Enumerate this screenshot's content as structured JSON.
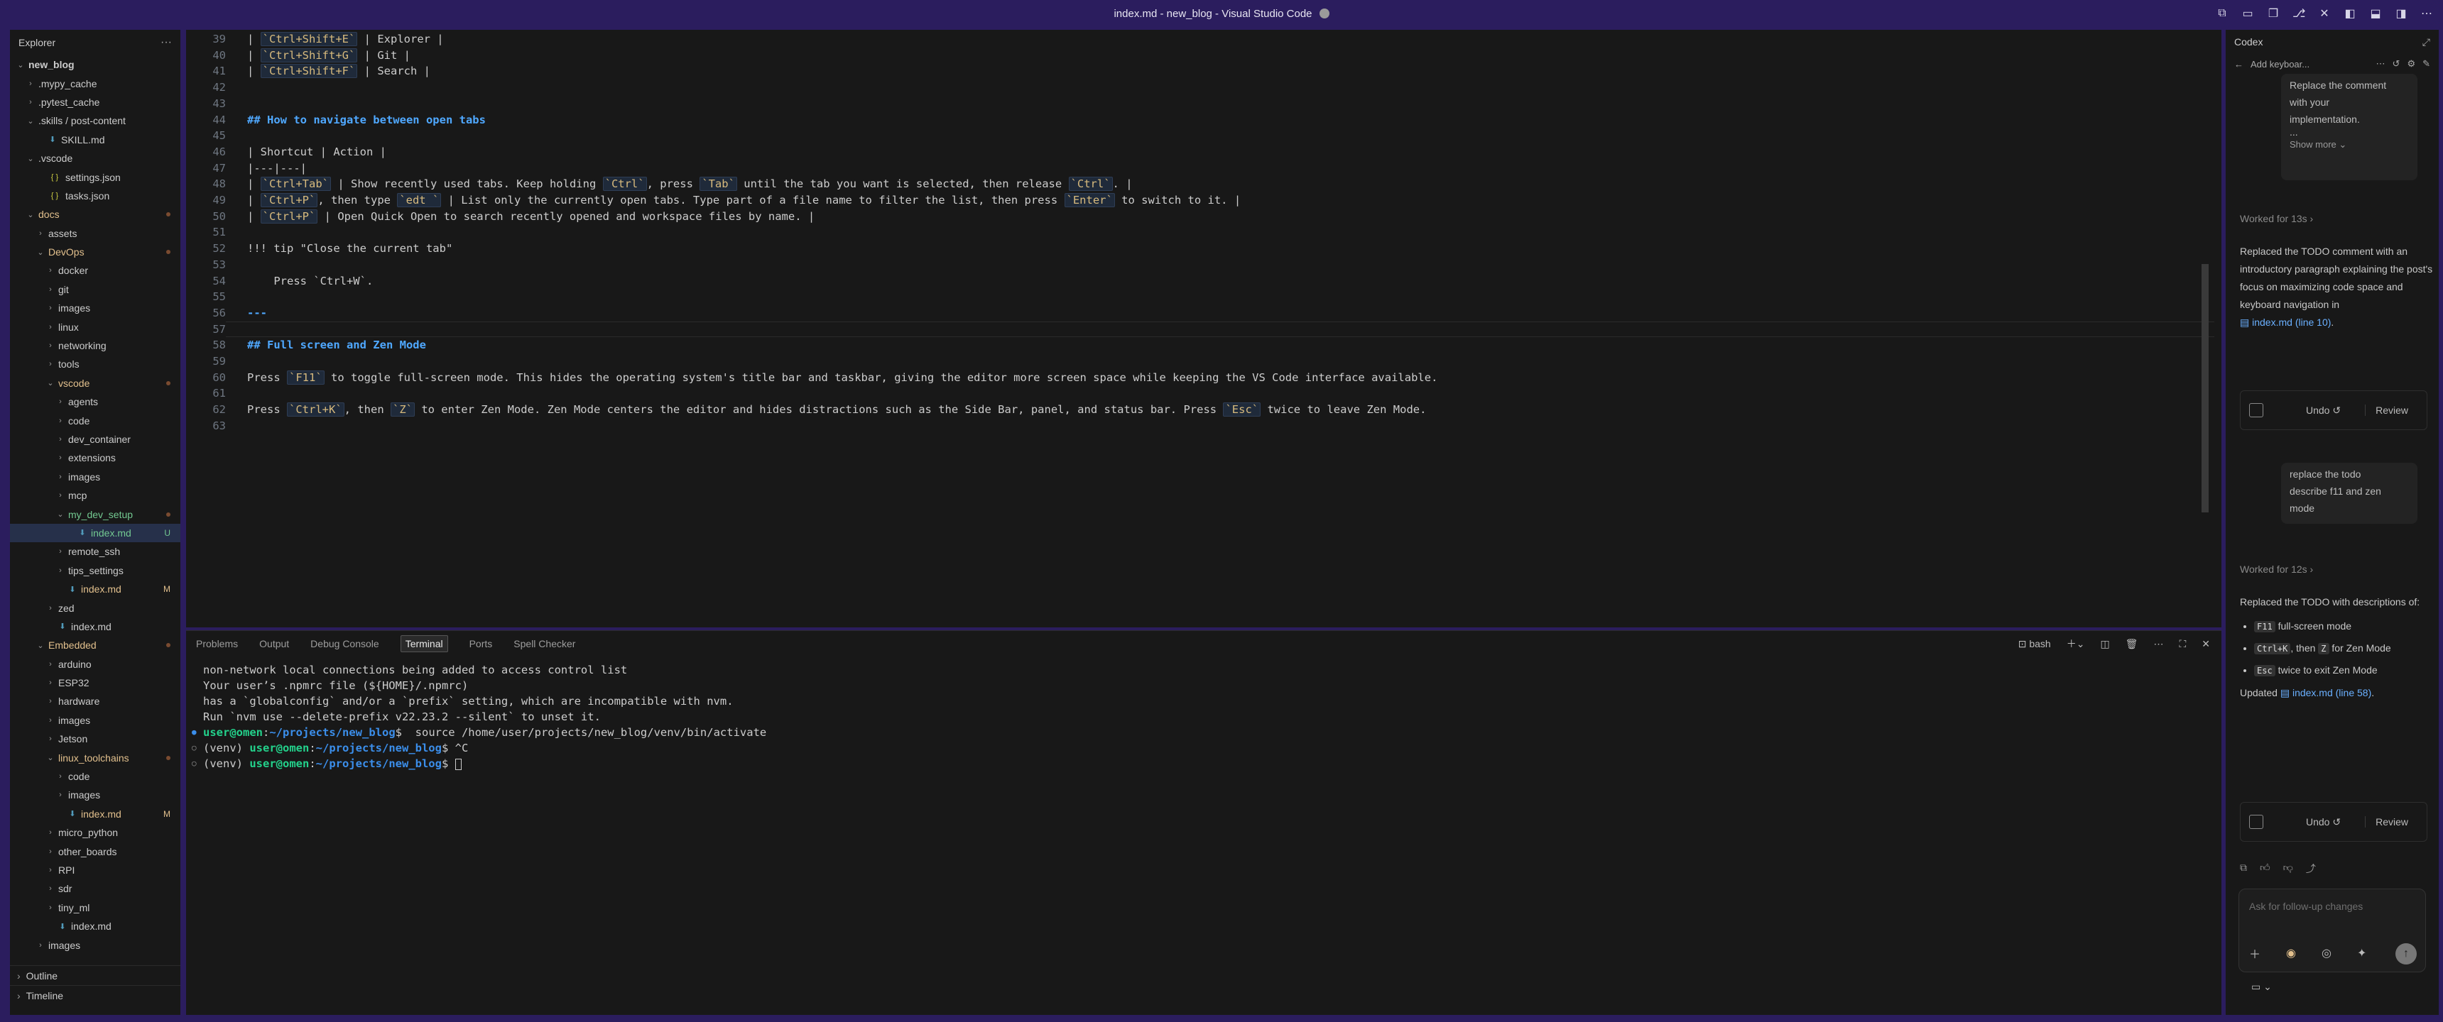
{
  "window": {
    "title": "index.md - new_blog - Visual Studio Code"
  },
  "explorer": {
    "title": "Explorer",
    "more": "···",
    "items": [
      {
        "label": "new_blog",
        "indent": 0,
        "kind": "root",
        "color": "def"
      },
      {
        "label": ".mypy_cache",
        "indent": 1,
        "kind": "folder",
        "color": "def"
      },
      {
        "label": ".pytest_cache",
        "indent": 1,
        "kind": "folder",
        "color": "def"
      },
      {
        "label": ".skills / post-content",
        "indent": 1,
        "kind": "open",
        "color": "def"
      },
      {
        "label": "SKILL.md",
        "indent": 2,
        "kind": "md",
        "color": "def"
      },
      {
        "label": ".vscode",
        "indent": 1,
        "kind": "open",
        "color": "def"
      },
      {
        "label": "settings.json",
        "indent": 2,
        "kind": "json",
        "color": "def"
      },
      {
        "label": "tasks.json",
        "indent": 2,
        "kind": "json",
        "color": "def"
      },
      {
        "label": "docs",
        "indent": 1,
        "kind": "open",
        "color": "mod",
        "dot": true
      },
      {
        "label": "assets",
        "indent": 2,
        "kind": "folder",
        "color": "def"
      },
      {
        "label": "DevOps",
        "indent": 2,
        "kind": "open",
        "color": "mod",
        "dot": true
      },
      {
        "label": "docker",
        "indent": 3,
        "kind": "folder",
        "color": "def"
      },
      {
        "label": "git",
        "indent": 3,
        "kind": "folder",
        "color": "def"
      },
      {
        "label": "images",
        "indent": 3,
        "kind": "folder",
        "color": "def"
      },
      {
        "label": "linux",
        "indent": 3,
        "kind": "folder",
        "color": "def"
      },
      {
        "label": "networking",
        "indent": 3,
        "kind": "folder",
        "color": "def"
      },
      {
        "label": "tools",
        "indent": 3,
        "kind": "folder",
        "color": "def"
      },
      {
        "label": "vscode",
        "indent": 3,
        "kind": "open",
        "color": "mod",
        "dot": true
      },
      {
        "label": "agents",
        "indent": 4,
        "kind": "folder",
        "color": "def"
      },
      {
        "label": "code",
        "indent": 4,
        "kind": "folder",
        "color": "def"
      },
      {
        "label": "dev_container",
        "indent": 4,
        "kind": "folder",
        "color": "def"
      },
      {
        "label": "extensions",
        "indent": 4,
        "kind": "folder",
        "color": "def"
      },
      {
        "label": "images",
        "indent": 4,
        "kind": "folder",
        "color": "def"
      },
      {
        "label": "mcp",
        "indent": 4,
        "kind": "folder",
        "color": "def"
      },
      {
        "label": "my_dev_setup",
        "indent": 4,
        "kind": "open",
        "color": "unt",
        "dot": true
      },
      {
        "label": "index.md",
        "indent": 5,
        "kind": "md",
        "color": "unt",
        "badge": "U",
        "selected": true
      },
      {
        "label": "remote_ssh",
        "indent": 4,
        "kind": "folder",
        "color": "def"
      },
      {
        "label": "tips_settings",
        "indent": 4,
        "kind": "folder",
        "color": "def"
      },
      {
        "label": "index.md",
        "indent": 4,
        "kind": "md",
        "color": "mod",
        "badge": "M"
      },
      {
        "label": "zed",
        "indent": 3,
        "kind": "folder",
        "color": "def"
      },
      {
        "label": "index.md",
        "indent": 3,
        "kind": "md",
        "color": "def"
      },
      {
        "label": "Embedded",
        "indent": 2,
        "kind": "open",
        "color": "mod",
        "dot": true
      },
      {
        "label": "arduino",
        "indent": 3,
        "kind": "folder",
        "color": "def"
      },
      {
        "label": "ESP32",
        "indent": 3,
        "kind": "folder",
        "color": "def"
      },
      {
        "label": "hardware",
        "indent": 3,
        "kind": "folder",
        "color": "def"
      },
      {
        "label": "images",
        "indent": 3,
        "kind": "folder",
        "color": "def"
      },
      {
        "label": "Jetson",
        "indent": 3,
        "kind": "folder",
        "color": "def"
      },
      {
        "label": "linux_toolchains",
        "indent": 3,
        "kind": "open",
        "color": "mod",
        "dot": true
      },
      {
        "label": "code",
        "indent": 4,
        "kind": "folder",
        "color": "def"
      },
      {
        "label": "images",
        "indent": 4,
        "kind": "folder",
        "color": "def"
      },
      {
        "label": "index.md",
        "indent": 4,
        "kind": "md",
        "color": "mod",
        "badge": "M"
      },
      {
        "label": "micro_python",
        "indent": 3,
        "kind": "folder",
        "color": "def"
      },
      {
        "label": "other_boards",
        "indent": 3,
        "kind": "folder",
        "color": "def"
      },
      {
        "label": "RPI",
        "indent": 3,
        "kind": "folder",
        "color": "def"
      },
      {
        "label": "sdr",
        "indent": 3,
        "kind": "folder",
        "color": "def"
      },
      {
        "label": "tiny_ml",
        "indent": 3,
        "kind": "folder",
        "color": "def"
      },
      {
        "label": "index.md",
        "indent": 3,
        "kind": "md",
        "color": "def"
      },
      {
        "label": "images",
        "indent": 2,
        "kind": "folder",
        "color": "def"
      }
    ],
    "outline": "Outline",
    "timeline": "Timeline"
  },
  "editor": {
    "lines": [
      {
        "n": "39",
        "t": [
          [
            "| ",
            ""
          ],
          [
            "`Ctrl+Shift+E`",
            "ic"
          ],
          [
            " | Explorer |",
            ""
          ]
        ]
      },
      {
        "n": "40",
        "t": [
          [
            "| ",
            ""
          ],
          [
            "`Ctrl+Shift+G`",
            "ic"
          ],
          [
            " | Git |",
            ""
          ]
        ]
      },
      {
        "n": "41",
        "t": [
          [
            "| ",
            ""
          ],
          [
            "`Ctrl+Shift+F`",
            "ic"
          ],
          [
            " | Search |",
            ""
          ]
        ]
      },
      {
        "n": "42",
        "t": []
      },
      {
        "n": "43",
        "t": []
      },
      {
        "n": "44",
        "t": [
          [
            "## How to navigate between open tabs",
            "h2"
          ]
        ]
      },
      {
        "n": "45",
        "t": []
      },
      {
        "n": "46",
        "t": [
          [
            "| Shortcut | Action |",
            ""
          ]
        ]
      },
      {
        "n": "47",
        "t": [
          [
            "|---|---|",
            ""
          ]
        ]
      },
      {
        "n": "48",
        "t": [
          [
            "| ",
            ""
          ],
          [
            "`Ctrl+Tab`",
            "ic"
          ],
          [
            " | Show recently used tabs. Keep holding ",
            ""
          ],
          [
            "`Ctrl`",
            "ic"
          ],
          [
            ", press ",
            ""
          ],
          [
            "`Tab`",
            "ic"
          ],
          [
            " until the tab you want is selected, then release ",
            ""
          ],
          [
            "`Ctrl`",
            "ic"
          ],
          [
            ". |",
            ""
          ]
        ]
      },
      {
        "n": "49",
        "t": [
          [
            "| ",
            ""
          ],
          [
            "`Ctrl+P`",
            "ic"
          ],
          [
            ", then type ",
            ""
          ],
          [
            "`edt `",
            "ic"
          ],
          [
            " | List only the currently open tabs. Type part of a file name to filter the list, then press ",
            ""
          ],
          [
            "`Enter`",
            "ic"
          ],
          [
            " to switch to it. |",
            ""
          ]
        ]
      },
      {
        "n": "50",
        "t": [
          [
            "| ",
            ""
          ],
          [
            "`Ctrl+P`",
            "ic"
          ],
          [
            " | Open Quick Open to search recently opened and workspace files by name. |",
            ""
          ]
        ]
      },
      {
        "n": "51",
        "t": []
      },
      {
        "n": "52",
        "t": [
          [
            "!!! tip \"Close the current tab\"",
            ""
          ]
        ]
      },
      {
        "n": "53",
        "t": []
      },
      {
        "n": "54",
        "t": [
          [
            "    Press `Ctrl+W`.",
            ""
          ]
        ]
      },
      {
        "n": "55",
        "t": []
      },
      {
        "n": "56",
        "t": [
          [
            "---",
            "h2"
          ]
        ]
      },
      {
        "n": "57",
        "t": []
      },
      {
        "n": "58",
        "t": [
          [
            "## Full screen and Zen Mode",
            "h2"
          ]
        ]
      },
      {
        "n": "59",
        "t": []
      },
      {
        "n": "60",
        "t": [
          [
            "Press ",
            ""
          ],
          [
            "`F11`",
            "ic"
          ],
          [
            " to toggle full-screen mode. This hides the operating system's title bar and taskbar, giving the editor more screen space while keeping the VS Code interface available.",
            ""
          ]
        ]
      },
      {
        "n": "61",
        "t": []
      },
      {
        "n": "62",
        "t": [
          [
            "Press ",
            ""
          ],
          [
            "`Ctrl+K`",
            "ic"
          ],
          [
            ", then ",
            ""
          ],
          [
            "`Z`",
            "ic"
          ],
          [
            " to enter Zen Mode. Zen Mode centers the editor and hides distractions such as the Side Bar, panel, and status bar. Press ",
            ""
          ],
          [
            "`Esc`",
            "ic"
          ],
          [
            " twice to leave Zen Mode.",
            ""
          ]
        ]
      },
      {
        "n": "63",
        "t": []
      }
    ]
  },
  "panel": {
    "tabs": [
      "Problems",
      "Output",
      "Debug Console",
      "Terminal",
      "Ports",
      "Spell Checker"
    ],
    "active": "Terminal",
    "shell": "bash",
    "terminal": [
      {
        "dot": "",
        "parts": [
          [
            "non-network local connections being added to access control list",
            ""
          ]
        ]
      },
      {
        "dot": "",
        "parts": [
          [
            "Your user’s .npmrc file (${HOME}/.npmrc)",
            ""
          ]
        ]
      },
      {
        "dot": "",
        "parts": [
          [
            "has a `globalconfig` and/or a `prefix` setting, which are incompatible with nvm.",
            ""
          ]
        ]
      },
      {
        "dot": "",
        "parts": [
          [
            "Run `nvm use --delete-prefix v22.23.2 --silent` to unset it.",
            ""
          ]
        ]
      },
      {
        "dot": "blue",
        "parts": [
          [
            "user@omen",
            "pg"
          ],
          [
            ":",
            ""
          ],
          [
            "~/projects/new_blog",
            "pb"
          ],
          [
            "$  source /home/user/projects/new_blog/venv/bin/activate",
            ""
          ]
        ]
      },
      {
        "dot": "open",
        "parts": [
          [
            "(venv) ",
            ""
          ],
          [
            "user@omen",
            "pg"
          ],
          [
            ":",
            ""
          ],
          [
            "~/projects/new_blog",
            "pb"
          ],
          [
            "$ ^C",
            ""
          ]
        ]
      },
      {
        "dot": "open",
        "parts": [
          [
            "(venv) ",
            ""
          ],
          [
            "user@omen",
            "pg"
          ],
          [
            ":",
            ""
          ],
          [
            "~/projects/new_blog",
            "pb"
          ],
          [
            "$ ",
            ""
          ]
        ]
      }
    ]
  },
  "chat": {
    "title": "Codex",
    "session": "Add keyboar...",
    "bubble1": [
      "Replace the comment",
      "with your",
      "implementation.",
      "..."
    ],
    "show_more": "Show more",
    "worked1": "Worked for 13s",
    "reply1": "Replaced the TODO comment with an introductory paragraph explaining the post's focus on maximizing code space and keyboard navigation in",
    "reply1_link": "index.md (line 10)",
    "undo": "Undo",
    "review": "Review",
    "bubble2": [
      "replace the todo",
      "describe f11 and zen",
      "mode"
    ],
    "worked2": "Worked for 12s",
    "reply2_intro": "Replaced the TODO with descriptions of:",
    "bullets": [
      {
        "keys": [
          "F11"
        ],
        "text": " full-screen mode"
      },
      {
        "keys": [
          "Ctrl+K"
        ],
        "mid": ", then ",
        "keys2": [
          "Z"
        ],
        "text": " for Zen Mode"
      },
      {
        "keys": [
          "Esc"
        ],
        "text": " twice to exit Zen Mode"
      }
    ],
    "updated": "Updated",
    "updated_link": "index.md (line 58)",
    "placeholder": "Ask for follow-up changes"
  }
}
